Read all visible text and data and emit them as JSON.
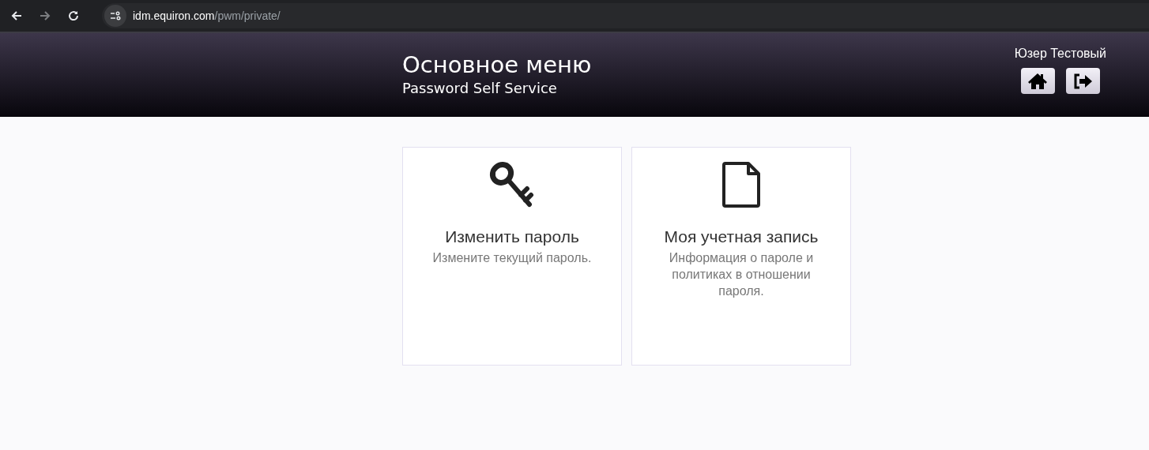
{
  "browser": {
    "url_host": "idm.equiron.com",
    "url_path": "/pwm/private/",
    "forward_disabled": true
  },
  "header": {
    "title": "Основное меню",
    "subtitle": "Password Self Service",
    "user_name": "Юзер Тестовый"
  },
  "tiles": [
    {
      "kind": "key",
      "title": "Изменить пароль",
      "description": "Измените текущий пароль."
    },
    {
      "kind": "document",
      "title": "Моя учетная запись",
      "description": "Информация о пароле и политиках в отношении пароля."
    }
  ]
}
